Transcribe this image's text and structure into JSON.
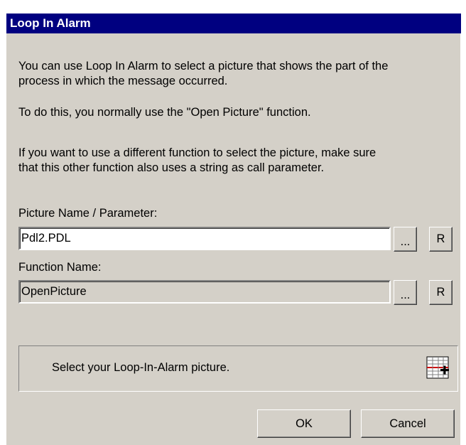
{
  "dialog": {
    "title": "Loop In Alarm",
    "intro_line1": "You can use Loop In Alarm to select a picture that shows the part of the",
    "intro_line2": "process in which the message occurred.",
    "intro_line3": "To do this, you normally use the \"Open Picture\" function.",
    "info_line1": "If you want to use a different function to select the picture, make sure",
    "info_line2": "that this other function also uses a string as call parameter."
  },
  "picture": {
    "label": "Picture Name / Parameter:",
    "value": "Pdl2.PDL",
    "browse_label": "...",
    "reset_label": "R"
  },
  "function": {
    "label": "Function Name:",
    "value": "OpenPicture",
    "browse_label": "...",
    "reset_label": "R"
  },
  "status": {
    "text": "Select your Loop-In-Alarm picture.",
    "icon": "picture-select-icon"
  },
  "buttons": {
    "ok": "OK",
    "cancel": "Cancel"
  },
  "colors": {
    "titlebar": "#000080",
    "face": "#d4d0c8",
    "field_active": "#ffffff"
  }
}
